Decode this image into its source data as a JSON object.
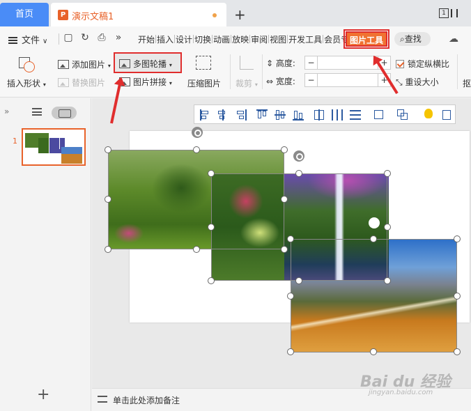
{
  "tabbar": {
    "home_label": "首页",
    "doc_icon": "P",
    "doc_title": "演示文稿1",
    "new_tab": "+",
    "page_box": "1"
  },
  "menubar": {
    "file_label": "文件",
    "items": [
      "开始",
      "插入",
      "设计",
      "切换",
      "动画",
      "放映",
      "审阅",
      "视图",
      "开发工具",
      "会员专享"
    ],
    "picture_tools": "图片工具",
    "search": "查找"
  },
  "ribbon": {
    "insert_shape": "插入形状",
    "add_picture": "添加图片",
    "replace_picture": "替换图片",
    "multi_carousel": "多图轮播",
    "picture_collage": "图片拼接",
    "compress": "压缩图片",
    "crop": "裁剪",
    "height_label": "高度:",
    "width_label": "宽度:",
    "height_value": "",
    "width_value": "",
    "lock_ratio": "锁定纵横比",
    "reset_size": "重设大小",
    "extra": "抠"
  },
  "left_panel": {
    "slide_number": "1",
    "collapse": "»",
    "add": "+"
  },
  "notes": {
    "placeholder": "单击此处添加备注"
  },
  "watermark": {
    "main": "Bai du 经验",
    "sub": "jingyan.baidu.com"
  },
  "colors": {
    "accent": "#e8622a",
    "highlight_border": "#e02d2d",
    "home_tab": "#4a8cf7"
  }
}
